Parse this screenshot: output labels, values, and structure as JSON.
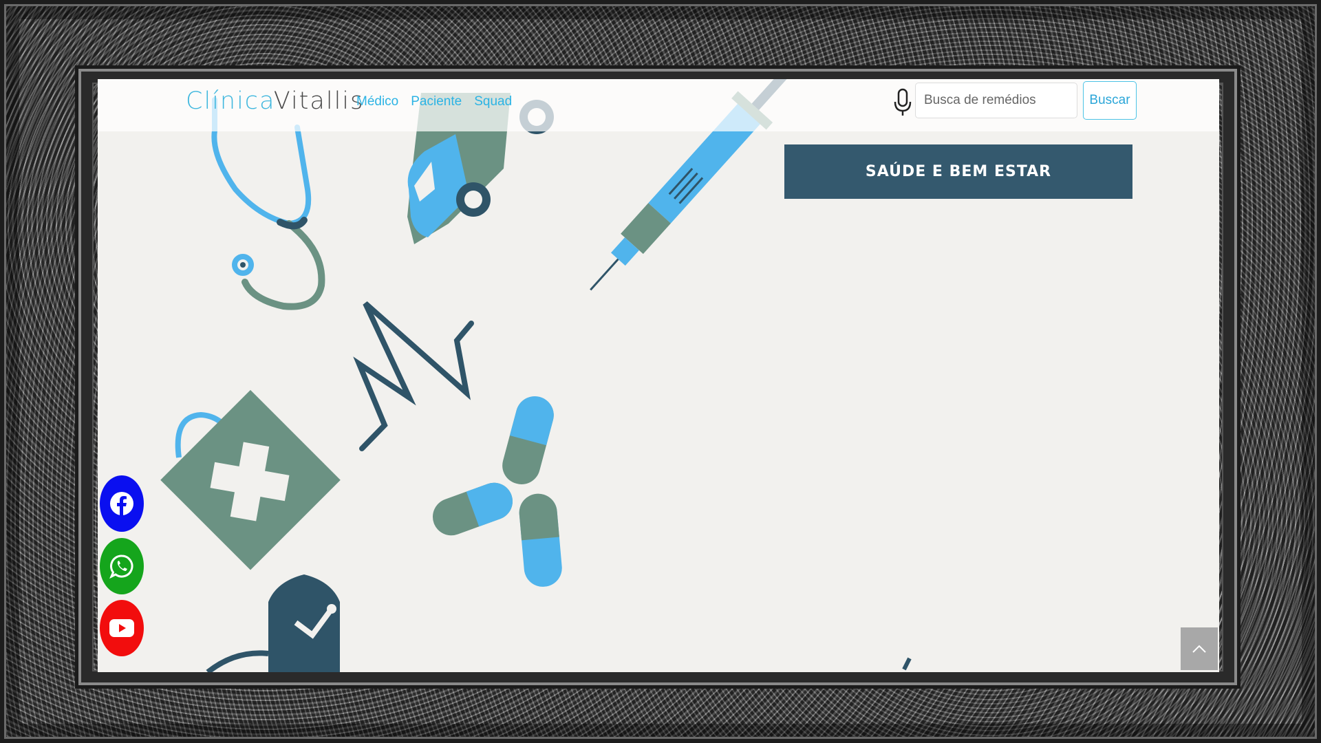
{
  "logo": {
    "part1": "Clínica",
    "part2": "Vitallis"
  },
  "nav": {
    "items": [
      {
        "label": "Médico"
      },
      {
        "label": "Paciente"
      },
      {
        "label": "Squad"
      }
    ]
  },
  "search": {
    "placeholder": "Busca de remédios",
    "value": "",
    "button_label": "Buscar"
  },
  "banner": {
    "title": "SAÚDE E BEM ESTAR"
  },
  "social": [
    {
      "name": "facebook",
      "color": "#0a0ff0"
    },
    {
      "name": "whatsapp",
      "color": "#15a51c"
    },
    {
      "name": "youtube",
      "color": "#f20d0d"
    }
  ],
  "colors": {
    "accent": "#2bb3e4",
    "banner_bg": "#34596e",
    "illus_blue": "#50b4ec",
    "illus_green": "#6b9283",
    "illus_dark": "#2f5468",
    "page_bg": "#f2f1ee"
  },
  "icons": {
    "mic": "microphone-icon",
    "scroll_top": "chevron-up-icon"
  }
}
